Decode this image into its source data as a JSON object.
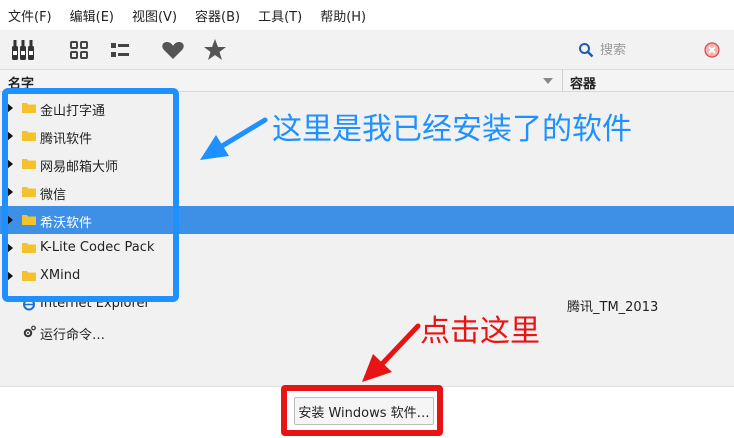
{
  "menu": [
    "文件(F)",
    "编辑(E)",
    "视图(V)",
    "容器(B)",
    "工具(T)",
    "帮助(H)"
  ],
  "toolbar": {
    "buttons": [
      "wine-bottles-icon",
      "grid-view-icon",
      "list-view-icon",
      "heart-icon",
      "star-icon"
    ],
    "search_placeholder": "搜索"
  },
  "columns": {
    "name": "名字",
    "container": "容器"
  },
  "rows": [
    {
      "label": "金山打字通",
      "type": "folder",
      "expandable": true,
      "container": ""
    },
    {
      "label": "腾讯软件",
      "type": "folder",
      "expandable": true,
      "container": ""
    },
    {
      "label": "网易邮箱大师",
      "type": "folder",
      "expandable": true,
      "container": ""
    },
    {
      "label": "微信",
      "type": "folder",
      "expandable": true,
      "container": ""
    },
    {
      "label": "希沃软件",
      "type": "folder",
      "expandable": true,
      "container": "",
      "selected": true
    },
    {
      "label": "K-Lite Codec Pack",
      "type": "folder",
      "expandable": true,
      "container": ""
    },
    {
      "label": "XMind",
      "type": "folder",
      "expandable": true,
      "container": ""
    },
    {
      "label": "Internet Explorer",
      "type": "app",
      "expandable": false,
      "container": "腾讯_TM_2013"
    },
    {
      "label": "运行命令…",
      "type": "app",
      "expandable": false,
      "container": ""
    }
  ],
  "install_button": "安装 Windows 软件…",
  "annotations": {
    "installed_note": "这里是我已经安装了的软件",
    "click_note": "点击这里",
    "blue_color": "#1e90ff",
    "red_color": "#e81414"
  },
  "colors": {
    "selection": "#3d90e6",
    "folder": "#f5c22b"
  }
}
